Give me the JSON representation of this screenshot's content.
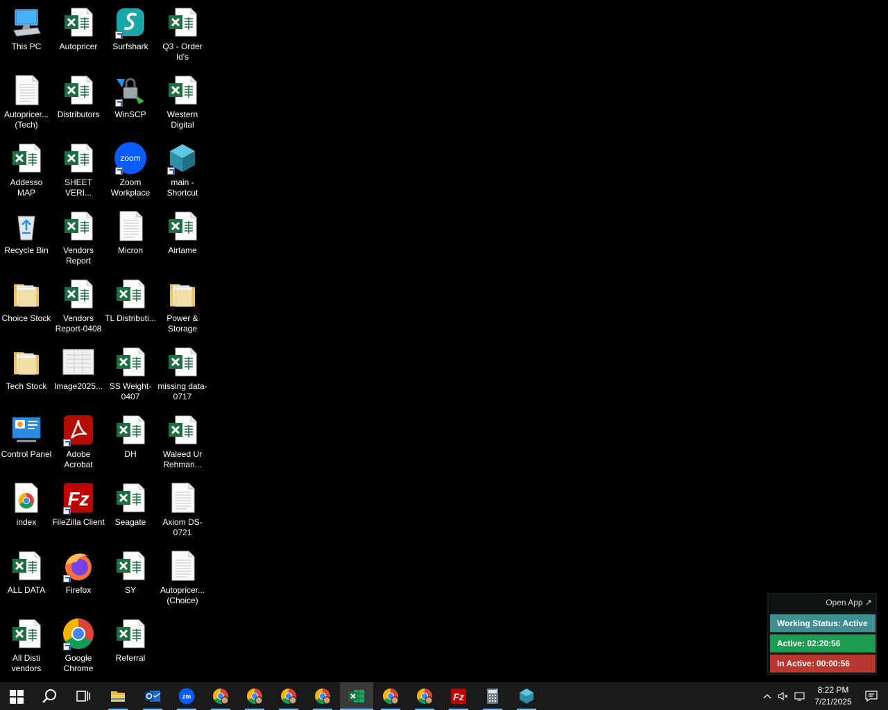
{
  "desktop": {
    "icons": [
      {
        "label": "This PC",
        "type": "pc"
      },
      {
        "label": "Autopricer",
        "type": "excel"
      },
      {
        "label": "Surfshark",
        "type": "surfshark",
        "shortcut": true
      },
      {
        "label": "Q3 - Order Id's",
        "type": "excel"
      },
      {
        "label": "Autopricer... (Tech)",
        "type": "doc"
      },
      {
        "label": "Distributors",
        "type": "excel"
      },
      {
        "label": "WinSCP",
        "type": "winscp",
        "shortcut": true
      },
      {
        "label": "Western Digital",
        "type": "excel"
      },
      {
        "label": "Addesso MAP",
        "type": "excel"
      },
      {
        "label": "SHEET VERI...",
        "type": "excel"
      },
      {
        "label": "Zoom Workplace",
        "type": "zoom",
        "shortcut": true
      },
      {
        "label": "main - Shortcut",
        "type": "main",
        "shortcut": true
      },
      {
        "label": "Recycle Bin",
        "type": "recycle"
      },
      {
        "label": "Vendors Report",
        "type": "excel"
      },
      {
        "label": "Micron",
        "type": "doc"
      },
      {
        "label": "Airtame",
        "type": "excel"
      },
      {
        "label": "Choice Stock",
        "type": "folder"
      },
      {
        "label": "Vendors Report-0408",
        "type": "excel"
      },
      {
        "label": "TL Distributi...",
        "type": "excel"
      },
      {
        "label": "Power & Storage",
        "type": "folder"
      },
      {
        "label": "Tech Stock",
        "type": "folder"
      },
      {
        "label": "Image2025...",
        "type": "image"
      },
      {
        "label": "SS Weight-0407",
        "type": "excel"
      },
      {
        "label": "missing data-0717",
        "type": "excel"
      },
      {
        "label": "Control Panel",
        "type": "control"
      },
      {
        "label": "Adobe Acrobat",
        "type": "acrobat",
        "shortcut": true
      },
      {
        "label": "DH",
        "type": "excel"
      },
      {
        "label": "Waleed Ur Rehman...",
        "type": "excel"
      },
      {
        "label": "index",
        "type": "chromefile"
      },
      {
        "label": "FileZilla Client",
        "type": "filezilla",
        "shortcut": true
      },
      {
        "label": "Seagate",
        "type": "excel"
      },
      {
        "label": "Axiom DS-0721",
        "type": "doc"
      },
      {
        "label": "ALL DATA",
        "type": "excel"
      },
      {
        "label": "Firefox",
        "type": "firefox",
        "shortcut": true
      },
      {
        "label": "SY",
        "type": "excel"
      },
      {
        "label": "Autopricer... (Choice)",
        "type": "doc"
      },
      {
        "label": "All Disti vendors",
        "type": "excel"
      },
      {
        "label": "Google Chrome",
        "type": "chrome",
        "shortcut": true
      },
      {
        "label": "Referral",
        "type": "excel"
      }
    ]
  },
  "status_widget": {
    "open_app": "Open App ↗",
    "working_status": "Working Status: Active",
    "active": "Active: 02:20:56",
    "inactive": "In Active: 00:00:56",
    "colors": {
      "working": "#3f8f92",
      "active": "#1e9c52",
      "inactive": "#b8372f"
    }
  },
  "taskbar": {
    "items": [
      {
        "name": "start",
        "icon": "windows-icon"
      },
      {
        "name": "search",
        "icon": "search-icon"
      },
      {
        "name": "task-view",
        "icon": "task-view-icon"
      },
      {
        "name": "file-explorer",
        "icon": "folder-icon",
        "open": true
      },
      {
        "name": "outlook",
        "icon": "outlook-icon",
        "open": true
      },
      {
        "name": "zoom",
        "icon": "zoom-icon",
        "open": true
      },
      {
        "name": "chrome-1",
        "icon": "chrome-icon",
        "open": true
      },
      {
        "name": "chrome-2",
        "icon": "chrome-icon",
        "open": true
      },
      {
        "name": "chrome-3",
        "icon": "chrome-icon",
        "open": true
      },
      {
        "name": "chrome-4",
        "icon": "chrome-icon",
        "open": true
      },
      {
        "name": "excel",
        "icon": "excel-icon",
        "open": true,
        "active": true
      },
      {
        "name": "chrome-5",
        "icon": "chrome-icon",
        "open": true
      },
      {
        "name": "chrome-6",
        "icon": "chrome-icon",
        "open": true
      },
      {
        "name": "filezilla",
        "icon": "filezilla-icon",
        "open": true
      },
      {
        "name": "calculator",
        "icon": "calculator-icon",
        "open": true
      },
      {
        "name": "main-app",
        "icon": "main-app-icon",
        "open": true
      }
    ],
    "clock": {
      "time": "8:22 PM",
      "date": "7/21/2025"
    }
  }
}
